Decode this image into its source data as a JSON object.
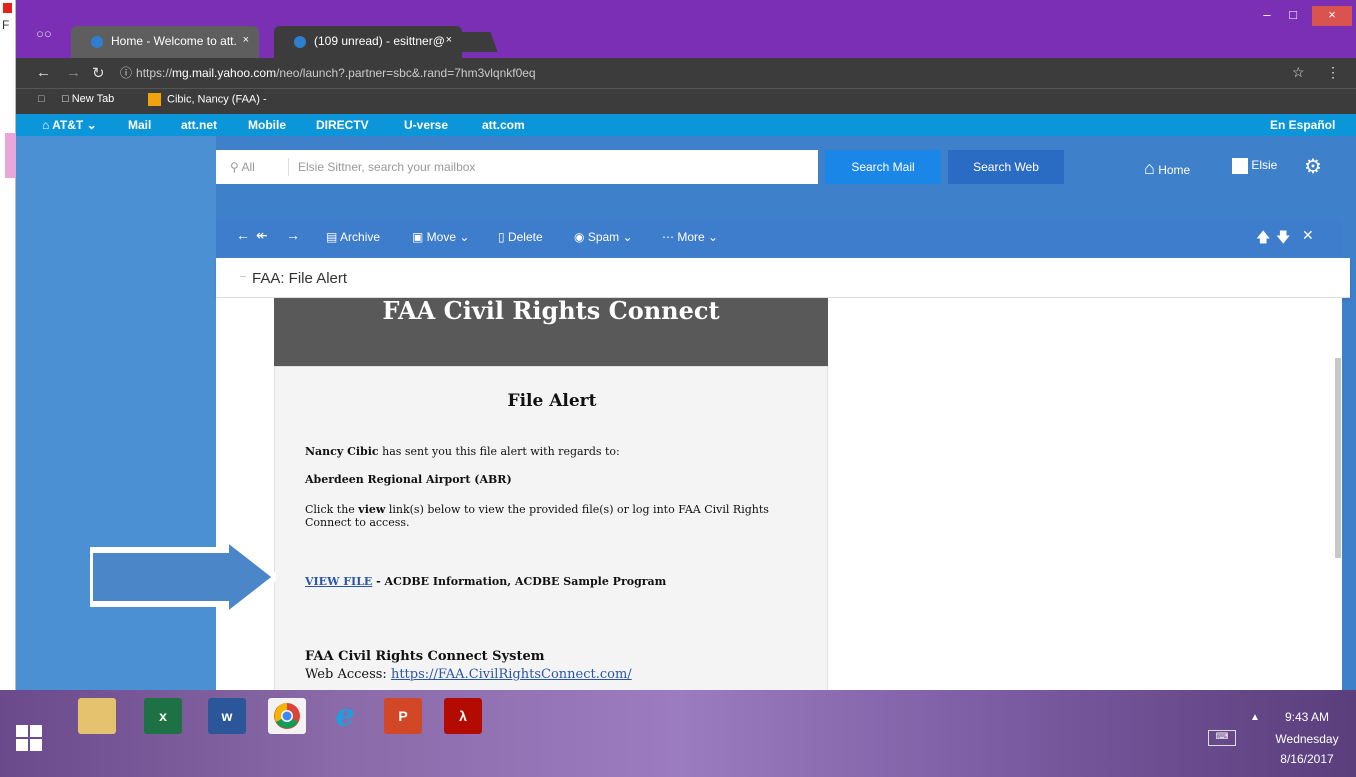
{
  "underlying": {
    "letter": "F"
  },
  "browser": {
    "tabs": [
      {
        "title": "Home - Welcome to att.",
        "close": "×"
      },
      {
        "title": "(109 unread) - esittner@",
        "close": "×"
      }
    ],
    "window_buttons": {
      "minimize": "–",
      "maximize": "□",
      "close": "×"
    },
    "url": {
      "scheme": "https://",
      "host": "mg.mail.yahoo.com",
      "path": "/neo/launch?.partner=sbc&.rand=7hm3vlqnkf0eq"
    },
    "bookmarks": [
      "New Tab",
      "Cibic, Nancy (FAA) -"
    ]
  },
  "att_nav": {
    "items": [
      "AT&T",
      "Mail",
      "att.net",
      "Mobile",
      "DIRECTV",
      "U-verse",
      "att.com"
    ],
    "espanol": "En Español"
  },
  "search": {
    "scope": "All",
    "placeholder": "Elsie Sittner, search your mailbox",
    "search_mail": "Search Mail",
    "search_web": "Search Web"
  },
  "header": {
    "home": "Home",
    "user": "Elsie"
  },
  "actions": {
    "archive": "Archive",
    "move": "Move",
    "delete": "Delete",
    "spam": "Spam",
    "more": "More"
  },
  "message": {
    "subject": "FAA: File Alert",
    "banner": "FAA Civil Rights Connect",
    "heading": "File Alert",
    "sender": "Nancy Cibic",
    "sender_text": " has sent you this file alert with regards to:",
    "regarding": "Aberdeen Regional Airport (ABR)",
    "instructions_pre": "Click the ",
    "instructions_view": "view",
    "instructions_post": " link(s) below to view the provided file(s) or log into FAA Civil Rights Connect to access.",
    "view_link": "VIEW FILE",
    "file_desc": " - ACDBE Information, ACDBE Sample Program",
    "footer_title": "FAA Civil Rights Connect System",
    "web_access_label": "Web Access: ",
    "web_access_url": "https://FAA.CivilRightsConnect.com/"
  },
  "taskbar": {
    "apps": [
      "File Explorer",
      "Excel",
      "Word",
      "Chrome",
      "Internet Explorer",
      "PowerPoint",
      "Acrobat"
    ],
    "excel_glyph": "x",
    "word_glyph": "w",
    "ppt_glyph": "P",
    "ie_glyph": "e",
    "time": "9:43 AM",
    "day": "Wednesday",
    "date": "8/16/2017"
  },
  "colors": {
    "chrome_frame": "#7a2fb4",
    "att_bar": "#0a96d8",
    "mail_bg": "#3e80c9",
    "search_mail_btn": "#1a87e8",
    "arrow": "#4a86c8"
  }
}
